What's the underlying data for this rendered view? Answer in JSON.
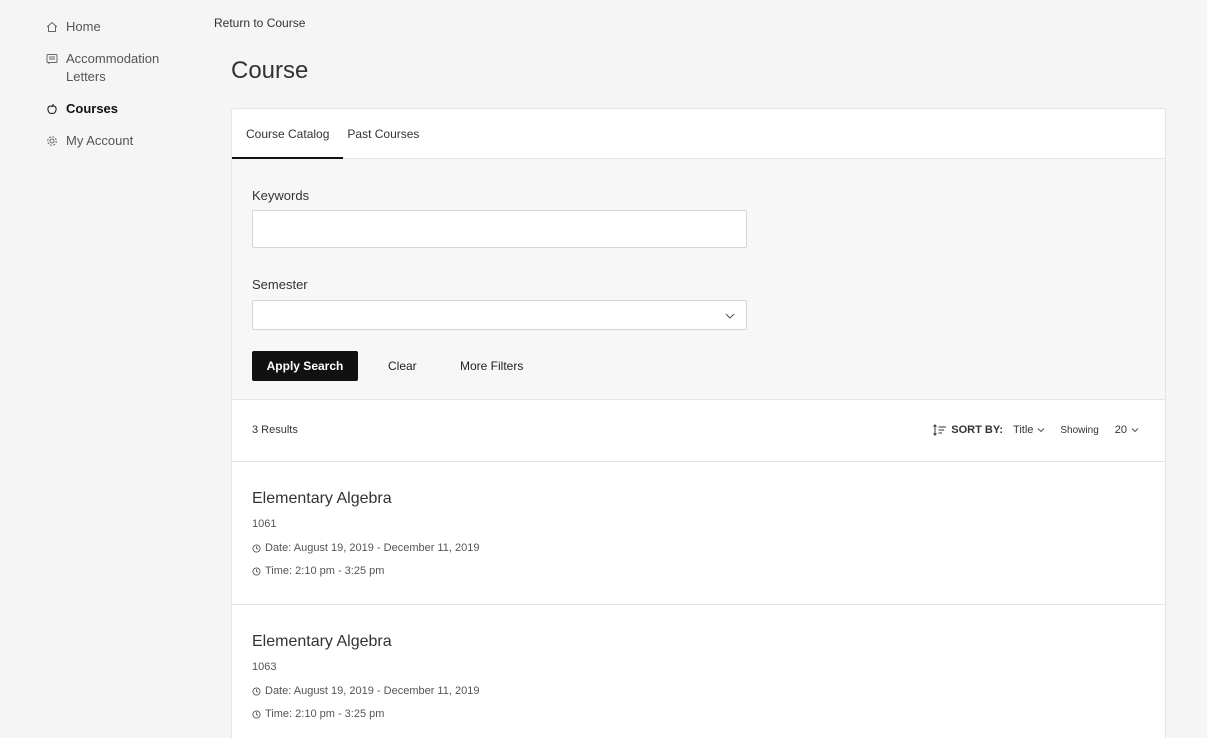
{
  "sidebar": {
    "items": [
      {
        "label": "Home",
        "icon": "home-icon"
      },
      {
        "label": "Accommodation Letters",
        "icon": "letter-icon"
      },
      {
        "label": "Courses",
        "icon": "apple-icon",
        "active": true
      },
      {
        "label": "My Account",
        "icon": "gear-icon"
      }
    ]
  },
  "header": {
    "return_link": "Return to Course",
    "title": "Course"
  },
  "tabs": [
    {
      "label": "Course Catalog",
      "active": true
    },
    {
      "label": "Past Courses",
      "active": false
    }
  ],
  "search": {
    "keywords_label": "Keywords",
    "keywords_value": "",
    "semester_label": "Semester",
    "semester_value": "",
    "apply_label": "Apply Search",
    "clear_label": "Clear",
    "more_filters_label": "More Filters"
  },
  "results": {
    "count_text": "3 Results",
    "sort_label": "SORT BY:",
    "sort_value": "Title",
    "showing_label": "Showing",
    "showing_value": "20"
  },
  "courses": [
    {
      "title": "Elementary Algebra",
      "number": "1061",
      "date": "Date: August 19, 2019 - December 11, 2019",
      "time": "Time: 2:10 pm - 3:25 pm"
    },
    {
      "title": "Elementary Algebra",
      "number": "1063",
      "date": "Date: August 19, 2019 - December 11, 2019",
      "time": "Time: 2:10 pm - 3:25 pm"
    }
  ],
  "colors": {
    "accent": "#111111",
    "background": "#f5f5f5",
    "panel": "#ffffff",
    "border": "#e4e4e4"
  }
}
